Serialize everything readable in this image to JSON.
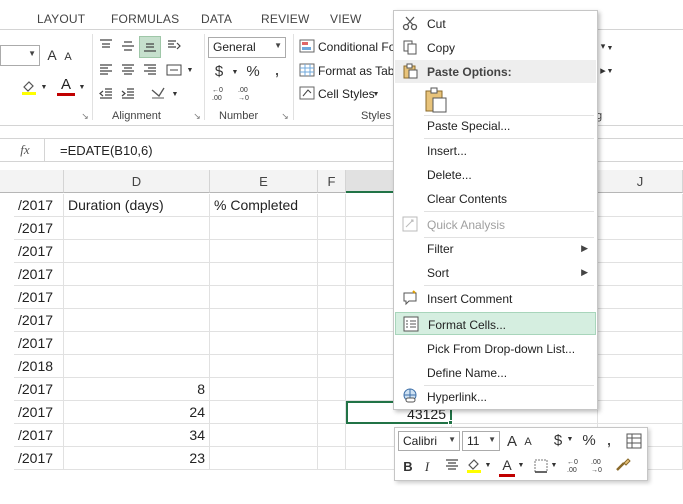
{
  "ribbon_tabs": [
    "LAYOUT",
    "FORMULAS",
    "DATA",
    "REVIEW",
    "VIEW"
  ],
  "ribbon": {
    "font_size_prefix": "A",
    "number_format": "General",
    "currency": "$",
    "percent": "%",
    "comma": ",",
    "conditional_formatting": "Conditional Fo",
    "format_as_table": "Format as Tab",
    "cell_styles": "Cell Styles",
    "groups": {
      "alignment": "Alignment",
      "number": "Number",
      "styles": "Styles",
      "editing": "g"
    },
    "fill_color": "#ffff00",
    "font_color": "#c00000"
  },
  "formula_bar": {
    "fx": "fx",
    "formula": "=EDATE(B10,6)"
  },
  "columns": [
    "D",
    "E",
    "F",
    "J"
  ],
  "rows": [
    {
      "c": "/2017",
      "d": "Duration (days)",
      "e": "% Completed"
    },
    {
      "c": "/2017",
      "d": "",
      "e": ""
    },
    {
      "c": "/2017",
      "d": "",
      "e": ""
    },
    {
      "c": "/2017",
      "d": "",
      "e": ""
    },
    {
      "c": "/2017",
      "d": "",
      "e": ""
    },
    {
      "c": "/2017",
      "d": "",
      "e": ""
    },
    {
      "c": "/2017",
      "d": "",
      "e": ""
    },
    {
      "c": "/2018",
      "d": "",
      "e": ""
    },
    {
      "c": "/2017",
      "d": "8",
      "e": ""
    },
    {
      "c": "/2017",
      "d": "24",
      "e": ""
    },
    {
      "c": "/2017",
      "d": "34",
      "e": ""
    },
    {
      "c": "/2017",
      "d": "23",
      "e": ""
    }
  ],
  "selected_value": "43125",
  "context_menu": {
    "cut": "Cut",
    "copy": "Copy",
    "paste_options": "Paste Options:",
    "paste_special": "Paste Special...",
    "insert": "Insert...",
    "delete": "Delete...",
    "clear_contents": "Clear Contents",
    "quick_analysis": "Quick Analysis",
    "filter": "Filter",
    "sort": "Sort",
    "insert_comment": "Insert Comment",
    "format_cells": "Format Cells...",
    "pick_from_dropdown": "Pick From Drop-down List...",
    "define_name": "Define Name...",
    "hyperlink": "Hyperlink..."
  },
  "mini_toolbar": {
    "font": "Calibri",
    "size": "11",
    "bold": "B",
    "italic": "I",
    "currency": "$",
    "percent": "%",
    "comma": ","
  }
}
